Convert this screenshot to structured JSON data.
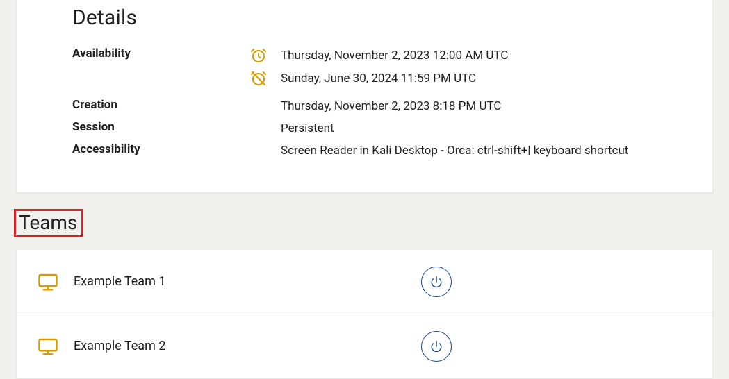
{
  "details": {
    "title": "Details",
    "availability": {
      "label": "Availability",
      "start": "Thursday, November 2, 2023 12:00 AM UTC",
      "end": "Sunday, June 30, 2024 11:59 PM UTC"
    },
    "creation": {
      "label": "Creation",
      "value": "Thursday, November 2, 2023 8:18 PM UTC"
    },
    "session": {
      "label": "Session",
      "value": "Persistent"
    },
    "accessibility": {
      "label": "Accessibility",
      "value": "Screen Reader in Kali Desktop - Orca: ctrl-shift+| keyboard shortcut"
    }
  },
  "teams": {
    "title": "Teams",
    "items": [
      {
        "name": "Example Team 1"
      },
      {
        "name": "Example Team 2"
      }
    ]
  },
  "colors": {
    "accent": "#d89b00",
    "powerBtn": "#1a4789"
  }
}
